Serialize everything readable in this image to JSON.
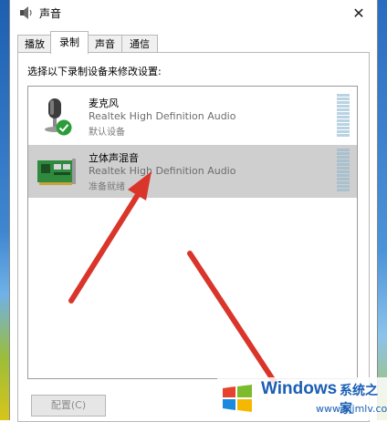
{
  "window": {
    "title": "声音",
    "close_glyph": "✕"
  },
  "tabs": [
    {
      "label": "播放",
      "active": false
    },
    {
      "label": "录制",
      "active": true
    },
    {
      "label": "声音",
      "active": false
    },
    {
      "label": "通信",
      "active": false
    }
  ],
  "panel": {
    "instruction": "选择以下录制设备来修改设置:"
  },
  "devices": [
    {
      "name": "麦克风",
      "description": "Realtek High Definition Audio",
      "status": "默认设备",
      "icon": "microphone-icon",
      "default_badge": "check-icon",
      "selected": false
    },
    {
      "name": "立体声混音",
      "description": "Realtek High Definition Audio",
      "status": "准备就绪",
      "icon": "sound-card-icon",
      "selected": true
    }
  ],
  "buttons": {
    "configure": "配置(C)"
  },
  "watermark": {
    "brand": "Windows",
    "chinese": "系统之家",
    "url": "www.bjjmlv.com"
  },
  "colors": {
    "accent": "#1a5fb4",
    "selection": "#cfcfcf",
    "arrow": "#d9352b",
    "badge": "#2a9d3a"
  }
}
